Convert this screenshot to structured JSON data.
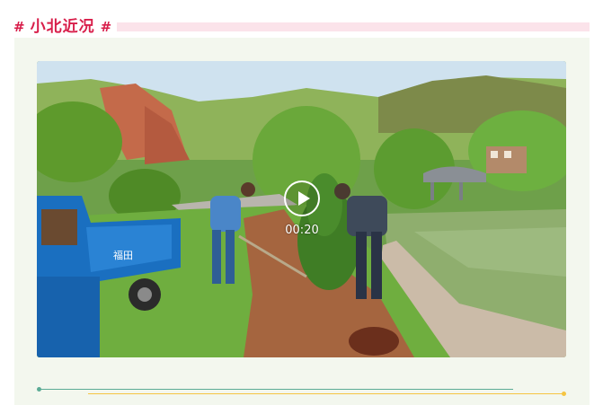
{
  "section": {
    "hash_left": "#",
    "title": "小北近况",
    "hash_right": "#"
  },
  "video": {
    "duration": "00:20",
    "truck_text": "福田"
  },
  "colors": {
    "title": "#d81e4a",
    "title_strip": "#fbe3ea",
    "card_bg": "#f3f7ee",
    "line_teal": "#5bab95",
    "line_yellow": "#f5c542"
  },
  "icons": [
    "play-icon"
  ]
}
